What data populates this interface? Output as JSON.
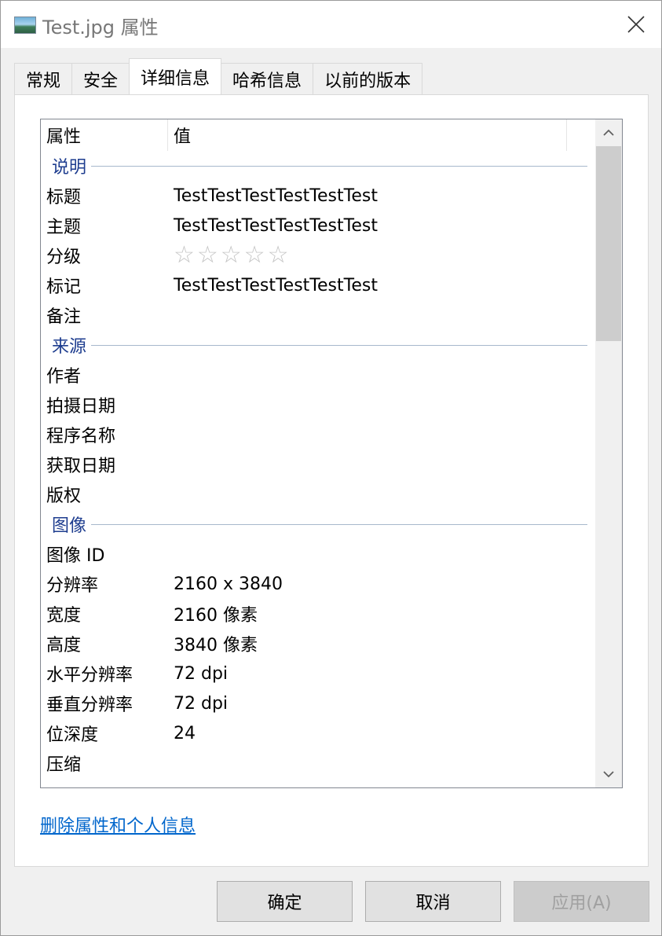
{
  "window": {
    "title": "Test.jpg 属性"
  },
  "tabs": [
    {
      "label": "常规",
      "active": false
    },
    {
      "label": "安全",
      "active": false
    },
    {
      "label": "详细信息",
      "active": true
    },
    {
      "label": "哈希信息",
      "active": false
    },
    {
      "label": "以前的版本",
      "active": false
    }
  ],
  "list": {
    "header": {
      "property": "属性",
      "value": "值"
    },
    "groups": [
      {
        "label": "说明",
        "rows": [
          {
            "key": "标题",
            "value": "TestTestTestTestTestTest"
          },
          {
            "key": "主题",
            "value": "TestTestTestTestTestTest"
          },
          {
            "key": "分级",
            "value": "☆☆☆☆☆"
          },
          {
            "key": "标记",
            "value": "TestTestTestTestTestTest"
          },
          {
            "key": "备注",
            "value": ""
          }
        ]
      },
      {
        "label": "来源",
        "rows": [
          {
            "key": "作者",
            "value": ""
          },
          {
            "key": "拍摄日期",
            "value": ""
          },
          {
            "key": "程序名称",
            "value": ""
          },
          {
            "key": "获取日期",
            "value": ""
          },
          {
            "key": "版权",
            "value": ""
          }
        ]
      },
      {
        "label": "图像",
        "rows": [
          {
            "key": "图像 ID",
            "value": ""
          },
          {
            "key": "分辨率",
            "value": "2160 x 3840"
          },
          {
            "key": "宽度",
            "value": "2160 像素"
          },
          {
            "key": "高度",
            "value": "3840 像素"
          },
          {
            "key": "水平分辨率",
            "value": "72 dpi"
          },
          {
            "key": "垂直分辨率",
            "value": "72 dpi"
          },
          {
            "key": "位深度",
            "value": "24"
          },
          {
            "key": "压缩",
            "value": ""
          }
        ]
      }
    ]
  },
  "link": {
    "label": "删除属性和个人信息"
  },
  "buttons": {
    "ok": "确定",
    "cancel": "取消",
    "apply": "应用(A)"
  },
  "colors": {
    "group_label": "#1e3d8f",
    "link": "#0066cc",
    "rating_star": "#c4c4c4"
  },
  "icons": {
    "close": "close-icon",
    "scroll_up": "chevron-up-icon",
    "scroll_down": "chevron-down-icon",
    "title": "image-file-icon"
  }
}
